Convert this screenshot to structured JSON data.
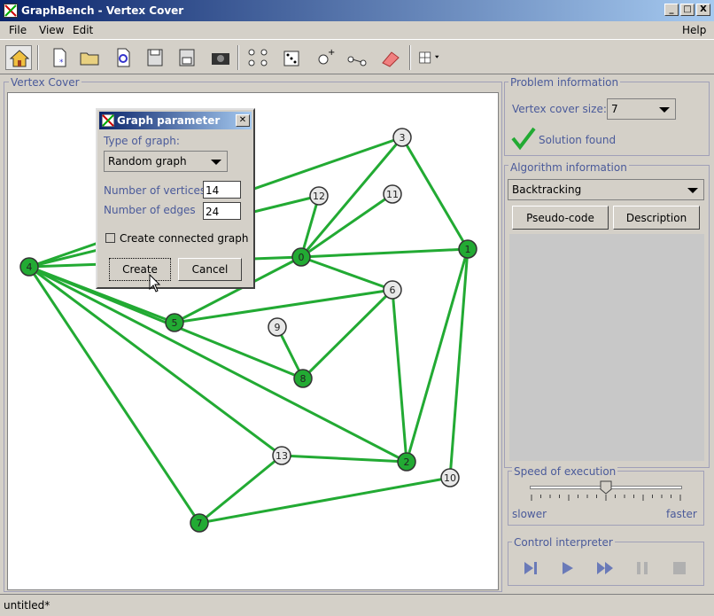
{
  "window": {
    "title": "GraphBench - Vertex Cover",
    "min": "_",
    "max": "□",
    "close": "X"
  },
  "menu": {
    "file": "File",
    "view": "View",
    "edit": "Edit",
    "help": "Help"
  },
  "toolbar": {
    "icons": [
      "home-icon",
      "new-file-icon",
      "open-folder-icon",
      "reload-icon",
      "save-icon",
      "save-as-icon",
      "camera-icon",
      "add-graph-icon",
      "random-graph-icon",
      "add-vertex-icon",
      "add-edge-icon",
      "eraser-icon",
      "grid-icon"
    ]
  },
  "panels": {
    "main_title": "Vertex Cover",
    "problem_title": "Problem information",
    "algorithm_title": "Algorithm information",
    "speed_title": "Speed of execution",
    "control_title": "Control interpreter"
  },
  "problem": {
    "vc_label": "Vertex cover size:",
    "vc_value": "7",
    "status": "Solution found"
  },
  "algorithm": {
    "selected": "Backtracking",
    "pseudo_btn": "Pseudo-code",
    "desc_btn": "Description"
  },
  "speed": {
    "slower": "slower",
    "faster": "faster",
    "level": 0.5
  },
  "dialog": {
    "title": "Graph parameter",
    "type_label": "Type of graph:",
    "type_value": "Random graph",
    "vertices_label": "Number of vertices",
    "vertices_value": "14",
    "edges_label": "Number of edges",
    "edges_value": "24",
    "connected_label": "Create connected graph",
    "connected_checked": false,
    "create": "Create",
    "cancel": "Cancel"
  },
  "status": {
    "file": "untitled*"
  },
  "graph": {
    "colors": {
      "edge": "#22aa33",
      "selected": "#22aa33",
      "unselected": "#e8e8e8"
    },
    "nodes": [
      {
        "id": "0",
        "selected": true
      },
      {
        "id": "1",
        "selected": true
      },
      {
        "id": "2",
        "selected": true
      },
      {
        "id": "3",
        "selected": false
      },
      {
        "id": "4",
        "selected": true
      },
      {
        "id": "5",
        "selected": true
      },
      {
        "id": "6",
        "selected": false
      },
      {
        "id": "7",
        "selected": true
      },
      {
        "id": "8",
        "selected": true
      },
      {
        "id": "9",
        "selected": false
      },
      {
        "id": "10",
        "selected": false
      },
      {
        "id": "11",
        "selected": false
      },
      {
        "id": "12",
        "selected": false
      },
      {
        "id": "13",
        "selected": false
      }
    ],
    "edges": [
      [
        "4",
        "0"
      ],
      [
        "4",
        "5"
      ],
      [
        "4",
        "8"
      ],
      [
        "4",
        "2"
      ],
      [
        "4",
        "7"
      ],
      [
        "4",
        "13"
      ],
      [
        "4",
        "12"
      ],
      [
        "4",
        "3"
      ],
      [
        "0",
        "3"
      ],
      [
        "0",
        "11"
      ],
      [
        "0",
        "12"
      ],
      [
        "0",
        "1"
      ],
      [
        "0",
        "6"
      ],
      [
        "0",
        "5"
      ],
      [
        "3",
        "1"
      ],
      [
        "1",
        "2"
      ],
      [
        "1",
        "10"
      ],
      [
        "6",
        "5"
      ],
      [
        "6",
        "8"
      ],
      [
        "6",
        "2"
      ],
      [
        "9",
        "8"
      ],
      [
        "13",
        "2"
      ],
      [
        "13",
        "7"
      ],
      [
        "7",
        "10"
      ]
    ]
  }
}
